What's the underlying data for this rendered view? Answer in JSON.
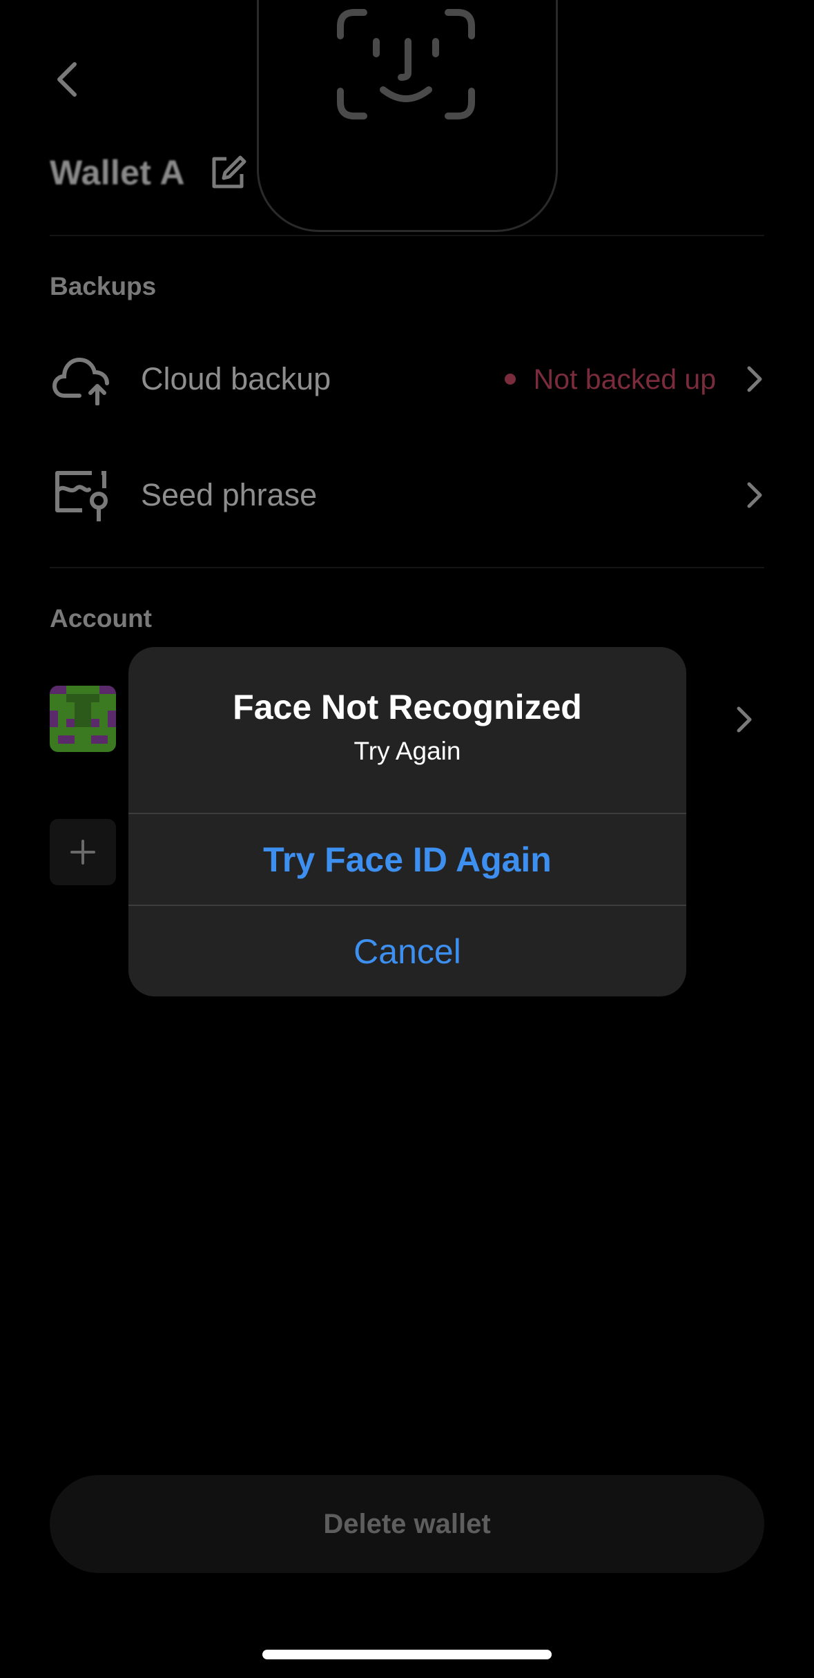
{
  "header": {
    "back_icon": "chevron-left-icon",
    "wallet_title": "Wallet A",
    "edit_icon": "edit-icon"
  },
  "backups": {
    "section_label": "Backups",
    "items": [
      {
        "label": "Cloud backup",
        "icon": "cloud-upload-icon",
        "status": "Not backed up",
        "status_color": "#7a2c3c"
      },
      {
        "label": "Seed phrase",
        "icon": "seed-key-icon"
      }
    ]
  },
  "account": {
    "section_label": "Account",
    "add_icon": "plus-icon"
  },
  "face_id_icon": "face-id-icon",
  "alert": {
    "title": "Face Not Recognized",
    "message": "Try Again",
    "primary_button": "Try Face ID Again",
    "cancel_button": "Cancel",
    "accent_color": "#3d8ff0"
  },
  "footer": {
    "delete_button": "Delete wallet"
  }
}
